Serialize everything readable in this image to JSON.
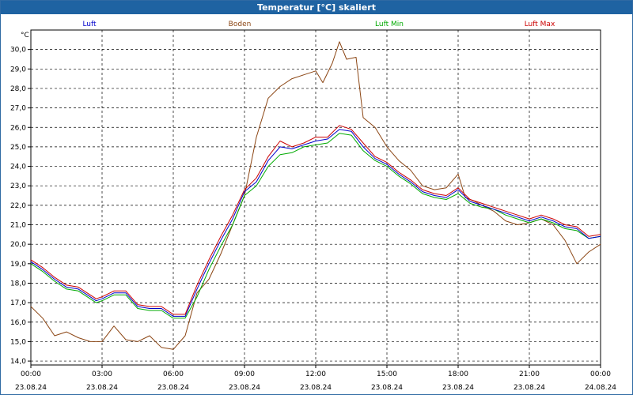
{
  "window": {
    "title": "Temperatur [°C] skaliert"
  },
  "chart_data": {
    "type": "line",
    "ylabel": "°C",
    "ylim": [
      13.8,
      31.0
    ],
    "y_ticks": [
      14.0,
      15.0,
      16.0,
      17.0,
      18.0,
      19.0,
      20.0,
      21.0,
      22.0,
      23.0,
      24.0,
      25.0,
      26.0,
      27.0,
      28.0,
      29.0,
      30.0
    ],
    "y_tick_labels": [
      "14,0",
      "15,0",
      "16,0",
      "17,0",
      "18,0",
      "19,0",
      "20,0",
      "21,0",
      "22,0",
      "23,0",
      "24,0",
      "25,0",
      "26,0",
      "27,0",
      "28,0",
      "29,0",
      "30,0"
    ],
    "xlim": [
      0,
      24
    ],
    "x_ticks": [
      0,
      3,
      6,
      9,
      12,
      15,
      18,
      21,
      24
    ],
    "x_tick_times": [
      "00:00",
      "03:00",
      "06:00",
      "09:00",
      "12:00",
      "15:00",
      "18:00",
      "21:00",
      "00:00"
    ],
    "x_tick_dates": [
      "23.08.24",
      "23.08.24",
      "23.08.24",
      "23.08.24",
      "23.08.24",
      "23.08.24",
      "23.08.24",
      "23.08.24",
      "24.08.24"
    ],
    "grid": true,
    "legend_position": "top",
    "series": [
      {
        "name": "Luft",
        "color": "#0000cc",
        "x": [
          0,
          0.5,
          1,
          1.5,
          2,
          2.5,
          2.75,
          3,
          3.5,
          4,
          4.5,
          5,
          5.5,
          6,
          6.5,
          7,
          7.5,
          8,
          8.5,
          9,
          9.5,
          10,
          10.5,
          11,
          11.5,
          12,
          12.5,
          13,
          13.5,
          14,
          14.5,
          15,
          15.5,
          16,
          16.5,
          17,
          17.5,
          18,
          18.5,
          19,
          19.5,
          20,
          20.5,
          21,
          21.5,
          22,
          22.5,
          23,
          23.5,
          24
        ],
        "y": [
          19.1,
          18.7,
          18.2,
          17.8,
          17.7,
          17.3,
          17.1,
          17.2,
          17.5,
          17.5,
          16.8,
          16.7,
          16.7,
          16.3,
          16.3,
          17.7,
          19.0,
          20.2,
          21.3,
          22.7,
          23.2,
          24.3,
          25.0,
          24.9,
          25.1,
          25.3,
          25.4,
          25.9,
          25.8,
          25.0,
          24.4,
          24.1,
          23.6,
          23.2,
          22.7,
          22.5,
          22.4,
          22.8,
          22.2,
          22.0,
          21.8,
          21.6,
          21.4,
          21.2,
          21.4,
          21.2,
          20.9,
          20.8,
          20.3,
          20.4
        ]
      },
      {
        "name": "Boden",
        "color": "#8b4513",
        "x": [
          0,
          0.5,
          1,
          1.5,
          2,
          2.5,
          3,
          3.5,
          4,
          4.5,
          5,
          5.5,
          6,
          6.5,
          7,
          7.5,
          8,
          8.5,
          9,
          9.5,
          10,
          10.5,
          11,
          11.5,
          12,
          12.3,
          12.7,
          13,
          13.3,
          13.7,
          14,
          14.5,
          15,
          15.5,
          16,
          16.5,
          17,
          17.5,
          18,
          18.3,
          18.7,
          19,
          19.5,
          20,
          20.5,
          21,
          21.5,
          22,
          22.5,
          23,
          23.5,
          24
        ],
        "y": [
          16.8,
          16.2,
          15.3,
          15.5,
          15.2,
          15.0,
          15.0,
          15.8,
          15.1,
          15.0,
          15.3,
          14.7,
          14.6,
          15.3,
          17.5,
          18.2,
          19.5,
          21.0,
          22.5,
          25.5,
          27.5,
          28.1,
          28.5,
          28.7,
          28.9,
          28.3,
          29.3,
          30.4,
          29.5,
          29.6,
          26.5,
          26.0,
          25.0,
          24.3,
          23.8,
          23.0,
          22.8,
          22.9,
          23.6,
          22.4,
          22.2,
          22.0,
          21.7,
          21.2,
          21.0,
          21.1,
          21.3,
          21.0,
          20.2,
          19.0,
          19.6,
          20.0
        ]
      },
      {
        "name": "Luft Min",
        "color": "#00aa00",
        "x": [
          0,
          0.5,
          1,
          1.5,
          2,
          2.5,
          2.75,
          3,
          3.5,
          4,
          4.5,
          5,
          5.5,
          6,
          6.5,
          7,
          7.5,
          8,
          8.5,
          9,
          9.5,
          10,
          10.5,
          11,
          11.5,
          12,
          12.5,
          13,
          13.5,
          14,
          14.5,
          15,
          15.5,
          16,
          16.5,
          17,
          17.5,
          18,
          18.5,
          19,
          19.5,
          20,
          20.5,
          21,
          21.5,
          22,
          22.5,
          23,
          23.5,
          24
        ],
        "y": [
          19.0,
          18.6,
          18.1,
          17.7,
          17.6,
          17.2,
          17.0,
          17.1,
          17.4,
          17.4,
          16.7,
          16.6,
          16.6,
          16.2,
          16.2,
          17.3,
          18.7,
          19.9,
          21.0,
          22.5,
          23.0,
          24.0,
          24.6,
          24.7,
          25.0,
          25.1,
          25.2,
          25.7,
          25.6,
          24.8,
          24.3,
          24.0,
          23.5,
          23.1,
          22.6,
          22.4,
          22.3,
          22.6,
          22.1,
          21.9,
          21.8,
          21.5,
          21.3,
          21.1,
          21.3,
          21.1,
          20.8,
          20.7,
          20.3,
          20.4
        ]
      },
      {
        "name": "Luft Max",
        "color": "#cc0000",
        "x": [
          0,
          0.5,
          1,
          1.5,
          2,
          2.5,
          2.75,
          3,
          3.5,
          4,
          4.5,
          5,
          5.5,
          6,
          6.5,
          7,
          7.5,
          8,
          8.5,
          9,
          9.5,
          10,
          10.5,
          11,
          11.5,
          12,
          12.5,
          13,
          13.5,
          14,
          14.5,
          15,
          15.5,
          16,
          16.5,
          17,
          17.5,
          18,
          18.5,
          19,
          19.5,
          20,
          20.5,
          21,
          21.5,
          22,
          22.5,
          23,
          23.5,
          24
        ],
        "y": [
          19.2,
          18.8,
          18.3,
          17.9,
          17.8,
          17.4,
          17.2,
          17.3,
          17.6,
          17.6,
          16.9,
          16.8,
          16.8,
          16.4,
          16.4,
          17.9,
          19.2,
          20.4,
          21.5,
          22.8,
          23.4,
          24.5,
          25.3,
          25.0,
          25.2,
          25.5,
          25.5,
          26.1,
          25.9,
          25.2,
          24.5,
          24.2,
          23.7,
          23.3,
          22.8,
          22.6,
          22.5,
          22.9,
          22.3,
          22.1,
          21.9,
          21.7,
          21.5,
          21.3,
          21.5,
          21.3,
          21.0,
          20.9,
          20.4,
          20.5
        ]
      }
    ]
  }
}
